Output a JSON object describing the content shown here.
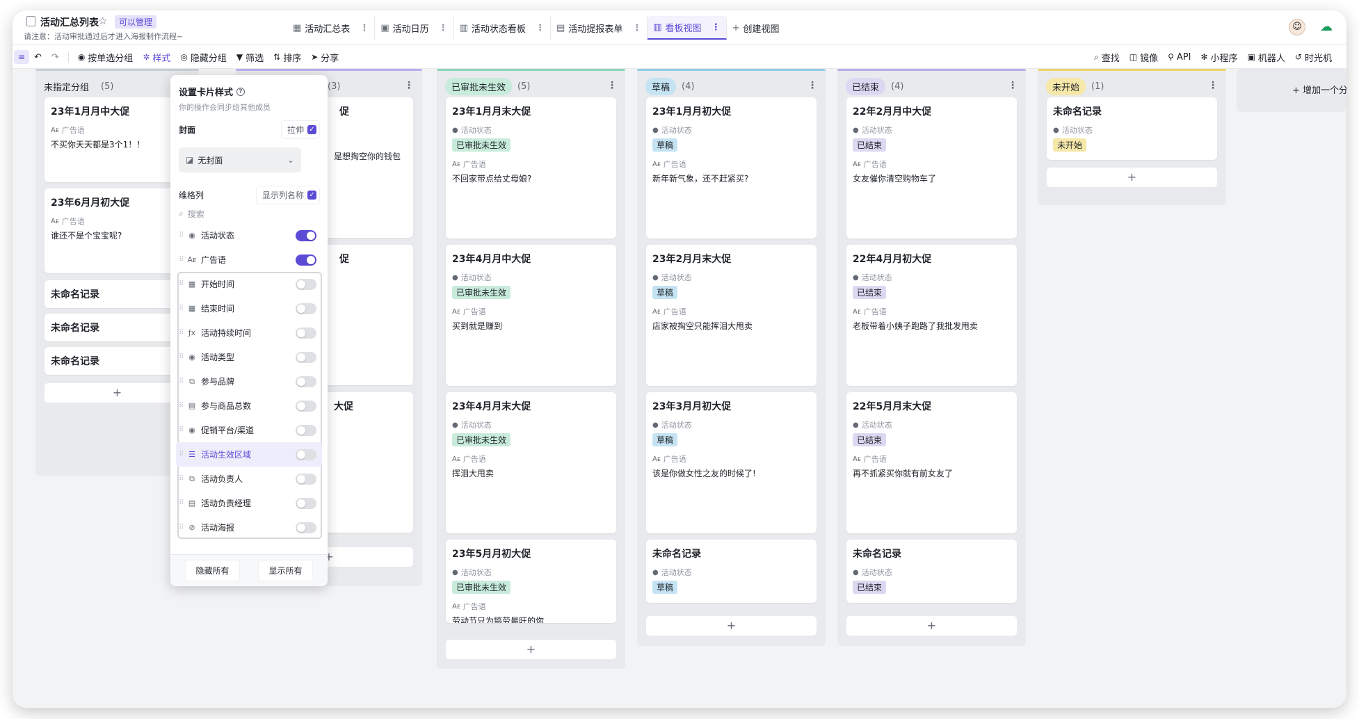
{
  "header": {
    "title": "活动汇总列表",
    "star_icon": "star-icon",
    "permission_badge": "可以管理",
    "notice": "请注意：活动审批通过后才进入海报制作流程~",
    "views": [
      {
        "label": "活动汇总表",
        "icon": "table-icon",
        "active": false
      },
      {
        "label": "活动日历",
        "icon": "calendar-icon",
        "active": false
      },
      {
        "label": "活动状态看板",
        "icon": "kanban-icon",
        "active": false
      },
      {
        "label": "活动提报表单",
        "icon": "form-icon",
        "active": false
      },
      {
        "label": "看板视图",
        "icon": "kanban-icon",
        "active": true
      }
    ],
    "create_view": "创建视图"
  },
  "toolbar": {
    "left": [
      {
        "label": "按单选分组",
        "icon": "group-icon"
      },
      {
        "label": "样式",
        "icon": "gear-icon",
        "active": true
      },
      {
        "label": "隐藏分组",
        "icon": "eye-icon"
      },
      {
        "label": "筛选",
        "icon": "filter-icon"
      },
      {
        "label": "排序",
        "icon": "sort-icon"
      },
      {
        "label": "分享",
        "icon": "share-icon"
      }
    ],
    "right": [
      {
        "label": "查找",
        "icon": "search-icon"
      },
      {
        "label": "镜像",
        "icon": "mirror-icon"
      },
      {
        "label": "API",
        "icon": "api-icon"
      },
      {
        "label": "小程序",
        "icon": "miniapp-icon"
      },
      {
        "label": "机器人",
        "icon": "robot-icon"
      },
      {
        "label": "时光机",
        "icon": "history-icon"
      }
    ]
  },
  "field_labels": {
    "status": "活动状态",
    "slogan": "广告语"
  },
  "columns": [
    {
      "label": "未指定分组",
      "count": "(5)",
      "color": "#e8eaed",
      "top": "#c9cdd4",
      "cards": [
        {
          "title": "23年1月月中大促",
          "slogan": "不买你天天都是3个1！！"
        },
        {
          "title": "23年6月月初大促",
          "slogan": "谁还不是个宝宝呢?"
        },
        {
          "title": "未命名记录"
        },
        {
          "title": "未命名记录"
        },
        {
          "title": "未命名记录"
        }
      ]
    },
    {
      "label": "",
      "count": "(3)",
      "color": "#e8eaed",
      "top": "#b8b0f0",
      "cards": [
        {
          "title": "促",
          "slogan": "是想掏空你的钱包"
        },
        {
          "title": "促"
        },
        {
          "title": "大促"
        }
      ]
    },
    {
      "label": "已审批未生效",
      "count": "(5)",
      "color": "#c8ebdb",
      "top": "#8ed6b6",
      "cards": [
        {
          "title": "23年1月月末大促",
          "status": "已审批未生效",
          "slogan": "不回家带点给丈母娘?"
        },
        {
          "title": "23年4月月中大促",
          "status": "已审批未生效",
          "slogan": "买到就是赚到"
        },
        {
          "title": "23年4月月末大促",
          "status": "已审批未生效",
          "slogan": "挥泪大甩卖"
        },
        {
          "title": "23年5月月初大促",
          "status": "已审批未生效",
          "slogan": "劳动节只为犒劳最旺的你"
        }
      ]
    },
    {
      "label": "草稿",
      "count": "(4)",
      "color": "#c5e3f3",
      "top": "#93cbe8",
      "cards": [
        {
          "title": "23年1月月初大促",
          "status": "草稿",
          "slogan": "新年新气象，还不赶紧买?"
        },
        {
          "title": "23年2月月末大促",
          "status": "草稿",
          "slogan": "店家被掏空只能挥泪大甩卖"
        },
        {
          "title": "23年3月月初大促",
          "status": "草稿",
          "slogan": "该是你做女性之友的时候了!"
        },
        {
          "title": "未命名记录",
          "status": "草稿"
        }
      ]
    },
    {
      "label": "已结束",
      "count": "(4)",
      "color": "#ddd8f2",
      "top": "#b8adea",
      "cards": [
        {
          "title": "22年2月月中大促",
          "status": "已结束",
          "slogan": "女友催你清空购物车了"
        },
        {
          "title": "22年4月月初大促",
          "status": "已结束",
          "slogan": "老板带着小姨子跑路了我批发甩卖"
        },
        {
          "title": "22年5月月末大促",
          "status": "已结束",
          "slogan": "再不抓紧买你就有前女友了"
        },
        {
          "title": "未命名记录",
          "status": "已结束"
        }
      ]
    },
    {
      "label": "未开始",
      "count": "(1)",
      "color": "#f6e8a9",
      "top": "#efd36a",
      "cards": [
        {
          "title": "未命名记录",
          "status": "未开始"
        }
      ]
    }
  ],
  "add_group": "增加一个分组",
  "add_card": "+",
  "style_popover": {
    "title": "设置卡片样式",
    "subtitle": "你的操作会同步给其他成员",
    "cover_label": "封面",
    "stretch_label": "拉伸",
    "cover_value": "无封面",
    "dimension_label": "维格列",
    "show_col_name": "显示列名称",
    "search_placeholder": "搜索",
    "fields": [
      {
        "name": "活动状态",
        "icon": "single-select-icon",
        "on": true
      },
      {
        "name": "广告语",
        "icon": "text-icon",
        "on": true
      },
      {
        "name": "开始时间",
        "icon": "calendar-icon",
        "on": false
      },
      {
        "name": "结束时间",
        "icon": "calendar-icon",
        "on": false
      },
      {
        "name": "活动持续时间",
        "icon": "formula-icon",
        "on": false
      },
      {
        "name": "活动类型",
        "icon": "single-select-icon",
        "on": false
      },
      {
        "name": "参与品牌",
        "icon": "link-icon",
        "on": false
      },
      {
        "name": "参与商品总数",
        "icon": "lookup-icon",
        "on": false
      },
      {
        "name": "促销平台/渠道",
        "icon": "single-select-icon",
        "on": false
      },
      {
        "name": "活动生效区域",
        "icon": "multi-select-icon",
        "on": false,
        "highlight": true
      },
      {
        "name": "活动负责人",
        "icon": "link-icon",
        "on": false
      },
      {
        "name": "活动负责经理",
        "icon": "lookup-icon",
        "on": false
      },
      {
        "name": "活动海报",
        "icon": "attachment-icon",
        "on": false
      }
    ],
    "hide_all": "隐藏所有",
    "show_all": "显示所有"
  },
  "colors": {
    "accent": "#5b4bd6",
    "approved": "#c8ebdb",
    "draft": "#c5e3f3",
    "ended": "#ddd8f2",
    "not_started": "#f6e8a9"
  }
}
